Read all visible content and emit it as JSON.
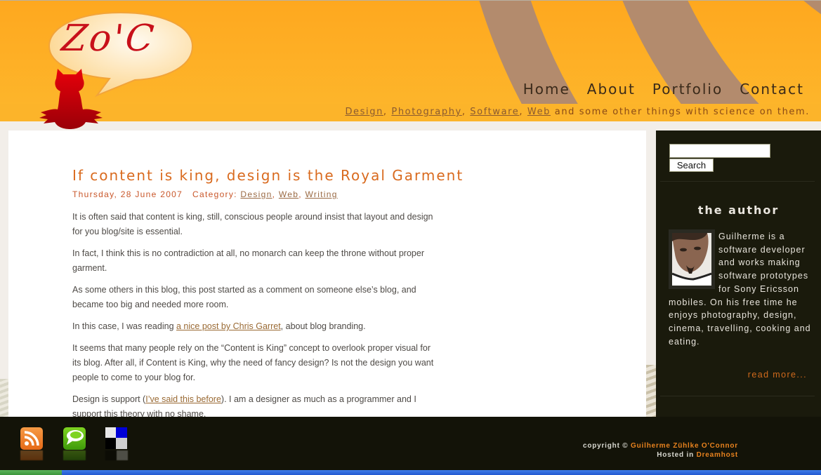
{
  "site": {
    "logo_text": "Zo'C",
    "nav": [
      {
        "label": "Home"
      },
      {
        "label": "About"
      },
      {
        "label": "Portfolio"
      },
      {
        "label": "Contact"
      }
    ],
    "tagline": {
      "links": [
        "Design",
        "Photography",
        "Software",
        "Web"
      ],
      "separator": ", ",
      "suffix": " and some other things with science on them."
    },
    "colors": {
      "header_orange": "#fea81f",
      "arc_brown": "#b38b6d",
      "accent": "#d96a1e",
      "sidebar_bg": "#1a1a0c"
    }
  },
  "post": {
    "title": "If content is king, design is the Royal Garment",
    "date": "Thursday, 28 June 2007",
    "category_label": "Category:",
    "categories": [
      "Design",
      "Web",
      "Writing"
    ],
    "paragraphs": {
      "p1": "It is often said that content is king, still, conscious people around insist that layout and design for you blog/site is essential.",
      "p2": "In fact, I think this is no contradiction at all, no monarch can keep the throne without proper garment.",
      "p3": "As some others in this blog, this post started as a comment on someone else’s blog, and became too big and needed more room.",
      "p4_before": "In this case, I was reading ",
      "p4_link": "a nice post by Chris Garret",
      "p4_after": ", about blog branding.",
      "p5": "It seems that many people rely on the “Content is King” concept to overlook proper visual for its blog. After all, if Content is King, why the need of fancy design? Is not the design you want people to come to your blog for.",
      "p6_before": "Design is support (",
      "p6_link": "I’ve said this before",
      "p6_after": "). I am a designer as much as a programmer and I support this theory with no shame."
    }
  },
  "sidebar": {
    "search": {
      "value": "",
      "placeholder": "",
      "button_label": "Search"
    },
    "author": {
      "title": "the author",
      "bio": "Guilherme is a software developer and works making software prototypes for Sony Ericsson mobiles. On his free time he enjoys photography, design, cinema, travelling, cooking and eating.",
      "read_more": "read more..."
    }
  },
  "footer": {
    "icons": [
      "rss-icon",
      "technorati-icon",
      "delicious-icon"
    ],
    "copyright_prefix": "copyright © ",
    "copyright_name": "Guilherme Zühlke O'Connor",
    "hosted_prefix": "Hosted in ",
    "hosted_name": "Dreamhost"
  }
}
